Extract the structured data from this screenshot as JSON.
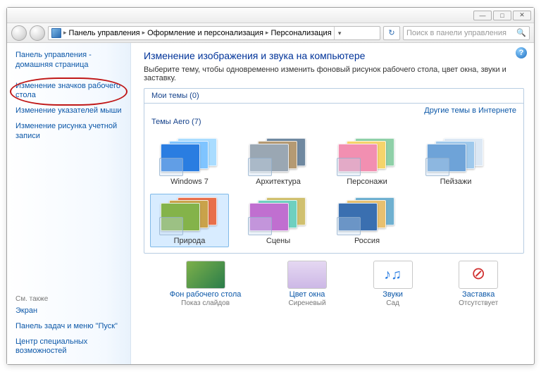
{
  "titlebar": {
    "min": "—",
    "max": "□",
    "close": "✕"
  },
  "nav": {
    "crumbs": [
      "Панель управления",
      "Оформление и персонализация",
      "Персонализация"
    ],
    "search_placeholder": "Поиск в панели управления"
  },
  "sidebar": {
    "home": "Панель управления - домашняя страница",
    "links": [
      "Изменение значков рабочего стола",
      "Изменение указателей мыши",
      "Изменение рисунка учетной записи"
    ],
    "seealso_h": "См. также",
    "seealso": [
      "Экран",
      "Панель задач и меню \"Пуск\"",
      "Центр специальных возможностей"
    ]
  },
  "main": {
    "heading": "Изменение изображения и звука на компьютере",
    "sub": "Выберите тему, чтобы одновременно изменить фоновый рисунок рабочего стола, цвет окна, звуки и заставку.",
    "my_themes": "Мои темы (0)",
    "more_link": "Другие темы в Интернете",
    "aero_label": "Темы Aero (7)",
    "themes": [
      {
        "label": "Windows 7",
        "c1": "#2a7de1",
        "c2": "#7fc4ff",
        "c3": "#a9dcff"
      },
      {
        "label": "Архитектура",
        "c1": "#9aa7b3",
        "c2": "#b59a73",
        "c3": "#6f88a0"
      },
      {
        "label": "Персонажи",
        "c1": "#f28fb1",
        "c2": "#f6d46b",
        "c3": "#8fd0a8"
      },
      {
        "label": "Пейзажи",
        "c1": "#6ea3d8",
        "c2": "#9fc9ec",
        "c3": "#dce8f4"
      },
      {
        "label": "Природа",
        "c1": "#84b34a",
        "c2": "#c9a24a",
        "c3": "#e86f4a",
        "selected": true
      },
      {
        "label": "Сцены",
        "c1": "#c06fd0",
        "c2": "#6fd0c0",
        "c3": "#d0c06f"
      },
      {
        "label": "Россия",
        "c1": "#3a6fb0",
        "c2": "#e8c070",
        "c3": "#6fb0d0"
      }
    ],
    "bottom": [
      {
        "label": "Фон рабочего стола",
        "value": "Показ слайдов",
        "bg": "linear-gradient(135deg,#7db04a,#2a7d4a)"
      },
      {
        "label": "Цвет окна",
        "value": "Сиреневый",
        "bg": "linear-gradient(#e5d8f2,#cdb8e6)"
      },
      {
        "label": "Звуки",
        "value": "Сад",
        "bg": "#fff"
      },
      {
        "label": "Заставка",
        "value": "Отсутствует",
        "bg": "#fff"
      }
    ]
  }
}
